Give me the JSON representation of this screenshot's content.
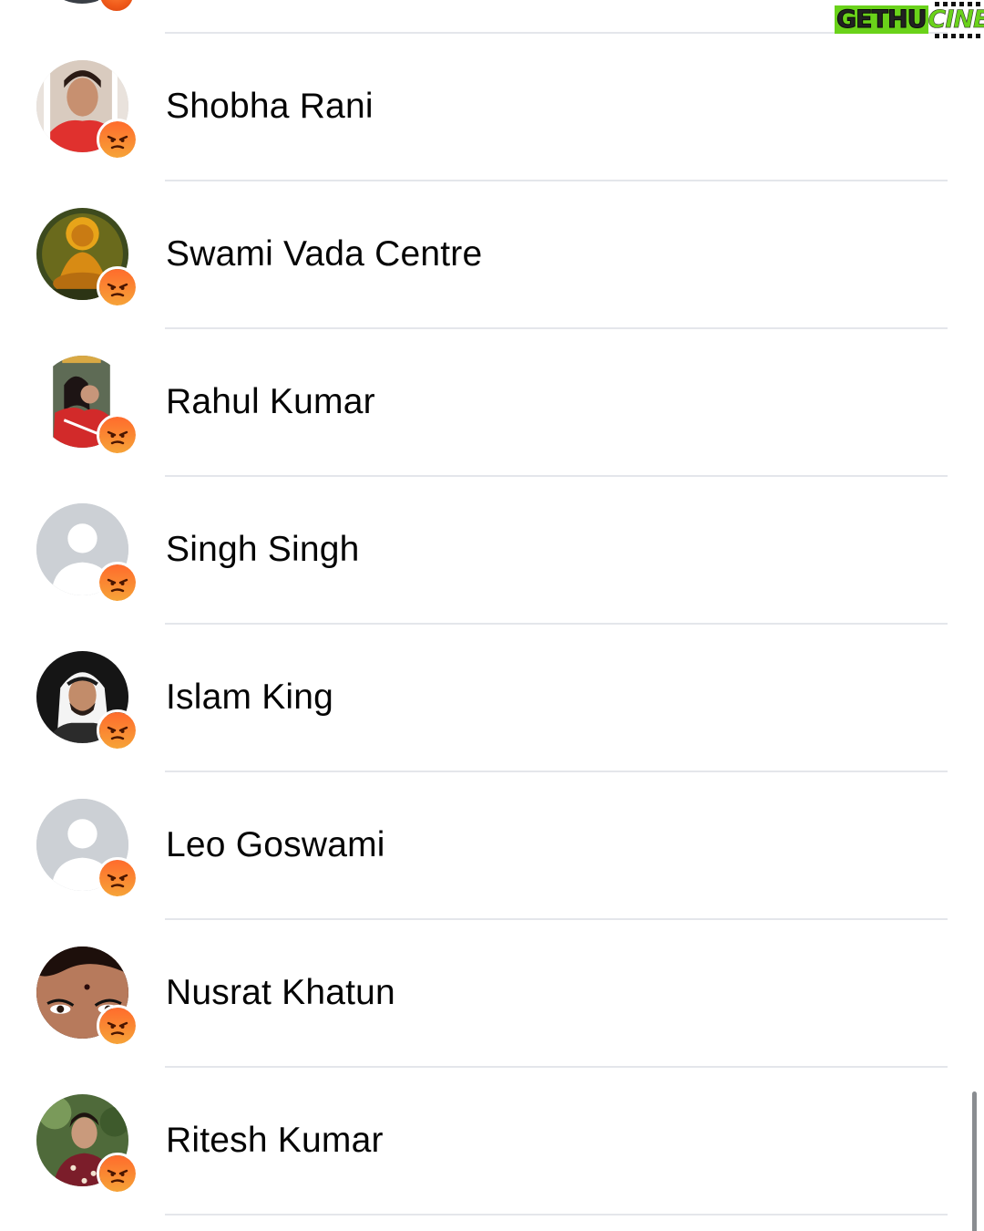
{
  "watermark": {
    "part1": "GETHU",
    "part2": "CINEMA"
  },
  "reaction": {
    "type": "angry",
    "color": "#f0611c"
  },
  "people": [
    {
      "name": "Shobha Rani",
      "avatar": "photo-person"
    },
    {
      "name": "Swami Vada Centre",
      "avatar": "photo-saint"
    },
    {
      "name": "Rahul Kumar",
      "avatar": "photo-couple"
    },
    {
      "name": "Singh Singh",
      "avatar": "default-silhouette"
    },
    {
      "name": "Islam King",
      "avatar": "photo-man-keffiyeh"
    },
    {
      "name": "Leo Goswami",
      "avatar": "default-silhouette"
    },
    {
      "name": "Nusrat Khatun",
      "avatar": "photo-face-closeup"
    },
    {
      "name": "Ritesh Kumar",
      "avatar": "photo-young-man"
    }
  ]
}
